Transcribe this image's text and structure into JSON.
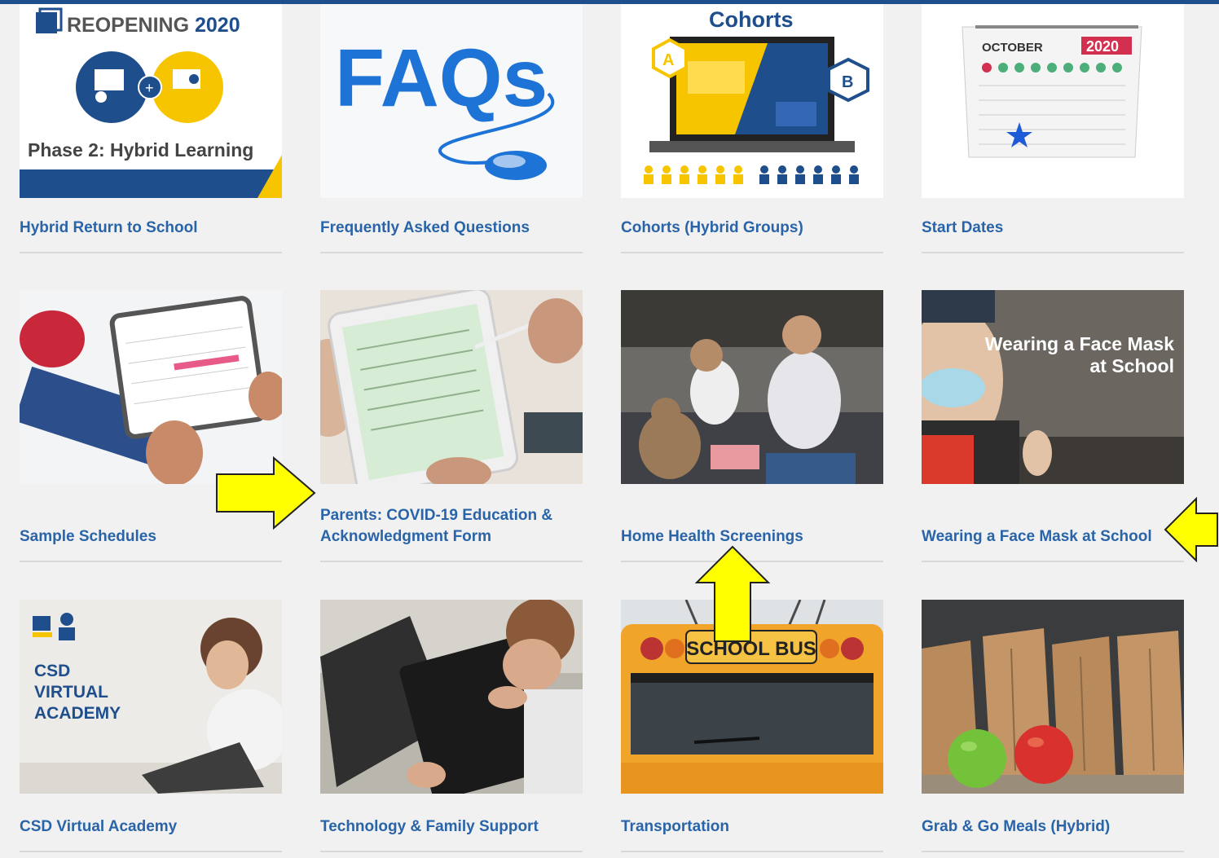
{
  "colors": {
    "link": "#2a64a8",
    "brand_blue": "#1f4e8c",
    "brand_yellow": "#f7c500",
    "arrow": "#ffff00"
  },
  "tiles": [
    {
      "name": "tile-hybrid-return",
      "label": "Hybrid Return to School",
      "image": {
        "title_a": "REOPENING",
        "title_b": "2020",
        "caption": "Phase 2: Hybrid Learning"
      }
    },
    {
      "name": "tile-faqs",
      "label": "Frequently Asked Questions",
      "image": {
        "title": "FAQs"
      }
    },
    {
      "name": "tile-cohorts",
      "label": "Cohorts (Hybrid Groups)",
      "image": {
        "title": "Cohorts",
        "badge_a": "A",
        "badge_b": "B"
      }
    },
    {
      "name": "tile-start-dates",
      "label": "Start Dates",
      "image": {
        "month": "OCTOBER",
        "year": "2020"
      }
    },
    {
      "name": "tile-sample-schedules",
      "label": "Sample Schedules",
      "image": {}
    },
    {
      "name": "tile-covid-form",
      "label_line1": "Parents: COVID-19 Education &",
      "label_line2": "Acknowledgment Form",
      "image": {}
    },
    {
      "name": "tile-home-health",
      "label": "Home Health Screenings",
      "image": {}
    },
    {
      "name": "tile-face-mask",
      "label": "Wearing a Face Mask at School",
      "image": {
        "overlay_line1": "Wearing a Face Mask",
        "overlay_line2": "at School"
      }
    },
    {
      "name": "tile-virtual-academy",
      "label": "CSD Virtual Academy",
      "image": {
        "line1": "CSD",
        "line2": "VIRTUAL",
        "line3": "ACADEMY"
      }
    },
    {
      "name": "tile-tech-support",
      "label": "Technology & Family Support",
      "image": {}
    },
    {
      "name": "tile-transportation",
      "label": "Transportation",
      "image": {
        "sign": "SCHOOL BUS"
      }
    },
    {
      "name": "tile-grab-go",
      "label": "Grab & Go Meals (Hybrid)",
      "image": {}
    }
  ]
}
